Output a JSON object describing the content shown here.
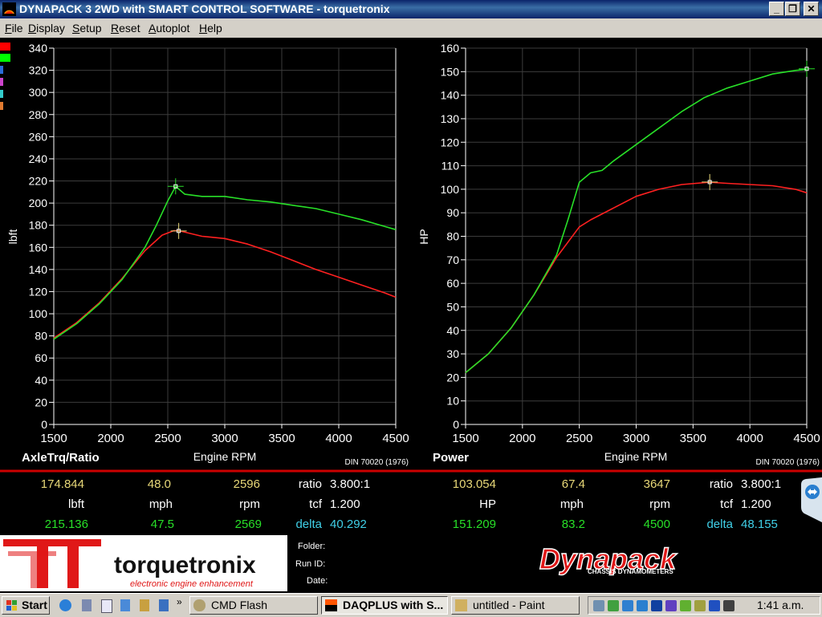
{
  "window": {
    "title": "DYNAPACK 3 2WD with SMART CONTROL SOFTWARE - torquetronix"
  },
  "menu": [
    "File",
    "Display",
    "Setup",
    "Reset",
    "Autoplot",
    "Help"
  ],
  "swatches": [
    {
      "name": "red-swatch",
      "color": "#ff0000"
    },
    {
      "name": "green-swatch",
      "color": "#00ff00"
    },
    {
      "name": "blue-swatch",
      "color": "#2a6cd8"
    },
    {
      "name": "magenta-swatch",
      "color": "#cc44cc"
    },
    {
      "name": "cyan-swatch",
      "color": "#33cccc"
    },
    {
      "name": "orange-swatch",
      "color": "#e07a30"
    }
  ],
  "colors": {
    "red": "#ff2020",
    "green": "#28e028",
    "yellow": "#e8d878",
    "cyan": "#40d0e8",
    "grid": "#3c3c3c",
    "divider": "#cc0000"
  },
  "chart_data": [
    {
      "type": "line",
      "title": "AxleTrq/Ratio",
      "xlabel": "Engine RPM",
      "ylabel": "lbft",
      "note": "DIN 70020 (1976)",
      "xlim": [
        1500,
        4500
      ],
      "ylim": [
        0,
        340
      ],
      "xticks": [
        1500,
        2000,
        2500,
        3000,
        3500,
        4000,
        4500
      ],
      "yticks": [
        0,
        20,
        40,
        60,
        80,
        100,
        120,
        140,
        160,
        180,
        200,
        220,
        240,
        260,
        280,
        300,
        320,
        340
      ],
      "series": [
        {
          "color": "red",
          "x": [
            1500,
            1700,
            1900,
            2100,
            2300,
            2450,
            2550,
            2600,
            2800,
            3000,
            3200,
            3400,
            3600,
            3800,
            4000,
            4200,
            4400,
            4500
          ],
          "y": [
            78,
            92,
            110,
            132,
            157,
            171,
            175,
            175,
            170,
            168,
            163,
            156,
            148,
            140,
            133,
            126,
            119,
            115
          ]
        },
        {
          "color": "green",
          "x": [
            1500,
            1700,
            1900,
            2100,
            2300,
            2400,
            2500,
            2569,
            2650,
            2800,
            3000,
            3200,
            3400,
            3600,
            3800,
            4000,
            4200,
            4400,
            4500
          ],
          "y": [
            77,
            91,
            109,
            131,
            160,
            180,
            202,
            215,
            208,
            206,
            206,
            203,
            201,
            198,
            195,
            190,
            185,
            179,
            176
          ]
        }
      ],
      "markers": [
        {
          "color": "red",
          "x": 2596,
          "y": 174.844
        },
        {
          "color": "green",
          "x": 2569,
          "y": 215.136
        }
      ]
    },
    {
      "type": "line",
      "title": "Power",
      "xlabel": "Engine RPM",
      "ylabel": "HP",
      "note": "DIN 70020 (1976)",
      "xlim": [
        1500,
        4500
      ],
      "ylim": [
        0,
        160
      ],
      "xticks": [
        1500,
        2000,
        2500,
        3000,
        3500,
        4000,
        4500
      ],
      "yticks": [
        0,
        10,
        20,
        30,
        40,
        50,
        60,
        70,
        80,
        90,
        100,
        110,
        120,
        130,
        140,
        150,
        160
      ],
      "series": [
        {
          "color": "red",
          "x": [
            1500,
            1700,
            1900,
            2100,
            2300,
            2500,
            2600,
            2800,
            3000,
            3200,
            3400,
            3647,
            3800,
            4000,
            4200,
            4400,
            4500
          ],
          "y": [
            22,
            30,
            41,
            55,
            71,
            84,
            87,
            92,
            97,
            100,
            102,
            103,
            102.5,
            102,
            101.5,
            100,
            98.5
          ]
        },
        {
          "color": "green",
          "x": [
            1500,
            1700,
            1900,
            2100,
            2300,
            2400,
            2500,
            2600,
            2700,
            2800,
            3000,
            3200,
            3400,
            3600,
            3800,
            4000,
            4200,
            4400,
            4500
          ],
          "y": [
            22,
            30,
            41,
            55,
            72,
            87,
            103,
            107,
            108,
            112,
            119,
            126,
            133,
            139,
            143,
            146,
            149,
            150.5,
            151
          ]
        }
      ],
      "markers": [
        {
          "color": "red",
          "x": 3647,
          "y": 103.054
        },
        {
          "color": "green",
          "x": 4500,
          "y": 151.209
        }
      ]
    }
  ],
  "readout_left": {
    "red": {
      "value": "174.844",
      "speed": "48.0",
      "rpm": "2596",
      "ratio_label": "ratio",
      "ratio": "3.800:1"
    },
    "units": {
      "value": "lbft",
      "speed": "mph",
      "rpm": "rpm",
      "tcf_label": "tcf",
      "tcf": "1.200"
    },
    "green": {
      "value": "215.136",
      "speed": "47.5",
      "rpm": "2569",
      "delta_label": "delta",
      "delta": "40.292"
    }
  },
  "readout_right": {
    "red": {
      "value": "103.054",
      "speed": "67.4",
      "rpm": "3647",
      "ratio_label": "ratio",
      "ratio": "3.800:1"
    },
    "units": {
      "value": "HP",
      "speed": "mph",
      "rpm": "rpm",
      "tcf_label": "tcf",
      "tcf": "1.200"
    },
    "green": {
      "value": "151.209",
      "speed": "83.2",
      "rpm": "4500",
      "delta_label": "delta",
      "delta": "48.155"
    }
  },
  "logo": {
    "brand": "torquetronix",
    "tagline": "electronic engine enhancement"
  },
  "fields": {
    "folder": "Folder:",
    "run_id": "Run ID:",
    "date": "Date:"
  },
  "dynapack": {
    "brand": "Dynapack",
    "sub": "CHASSIS DYNAMOMETERS"
  },
  "taskbar": {
    "start": "Start",
    "buttons": [
      {
        "label": "CMD Flash",
        "active": false
      },
      {
        "label": "DAQPLUS with S...",
        "active": true
      },
      {
        "label": "untitled - Paint",
        "active": false
      }
    ],
    "clock": "1:41 a.m."
  }
}
